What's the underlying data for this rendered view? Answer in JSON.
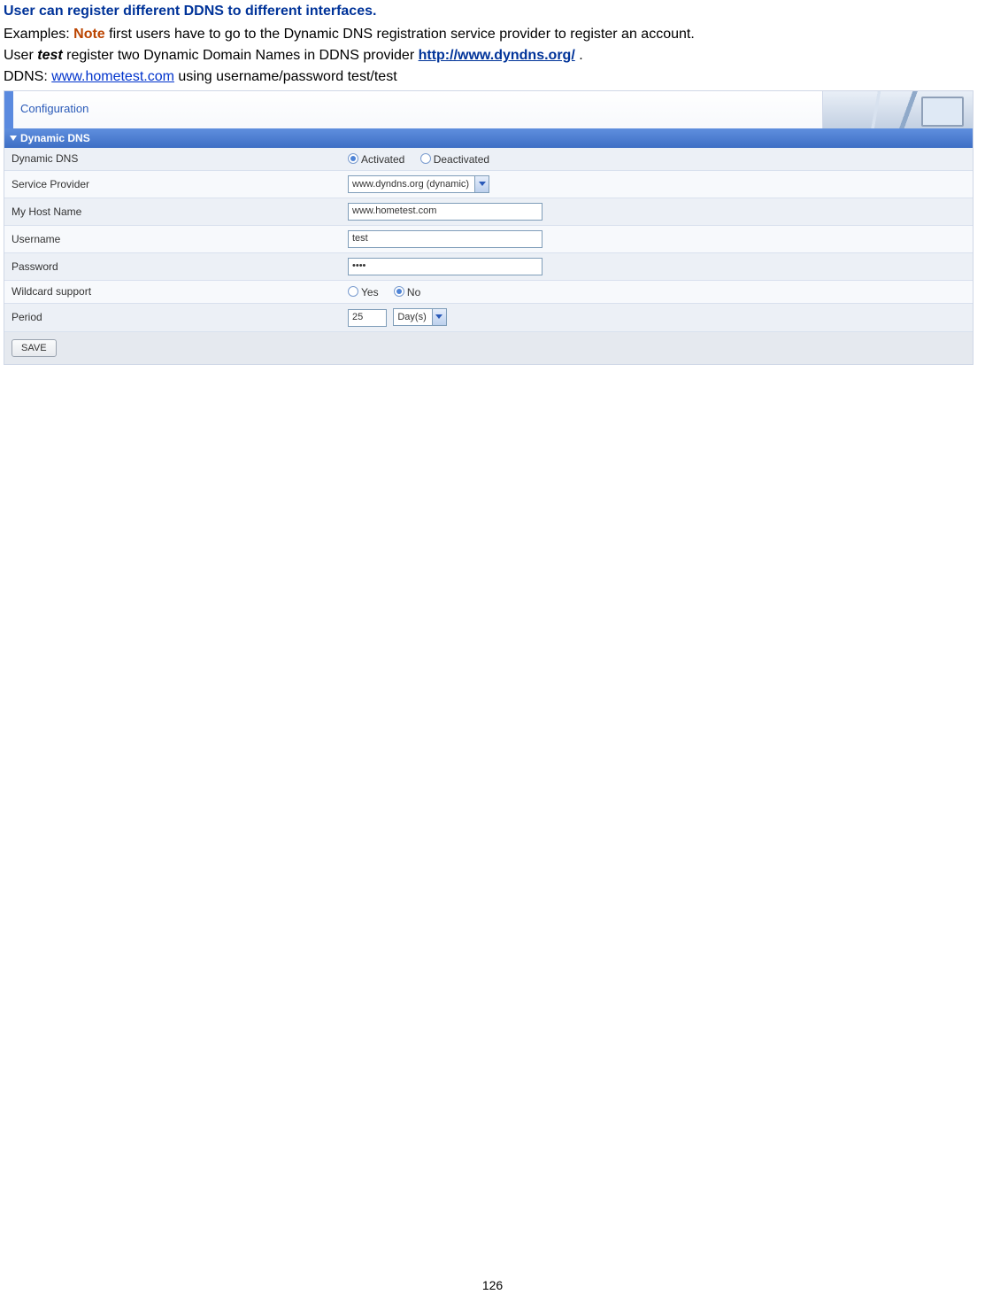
{
  "doc": {
    "heading": "User can register different DDNS to different interfaces.",
    "examples_prefix": "Examples: ",
    "note_word": "Note",
    "examples_rest": " first users have to go to the Dynamic DNS registration service provider to register an account.",
    "line2_a": "User ",
    "line2_user": "test",
    "line2_b": " register two Dynamic Domain Names in DDNS provider ",
    "line2_link": "http://www.dyndns.org/",
    "line2_end": " .",
    "line3_a": "DDNS: ",
    "line3_link": "www.hometest.com",
    "line3_b": " using username/password test/test"
  },
  "ui": {
    "banner_title": "Configuration",
    "section_title": "Dynamic DNS",
    "rows": {
      "dynamic_dns": {
        "label": "Dynamic DNS",
        "opt1": "Activated",
        "opt2": "Deactivated"
      },
      "service_provider": {
        "label": "Service Provider",
        "value": "www.dyndns.org (dynamic)"
      },
      "my_host_name": {
        "label": "My Host Name",
        "value": "www.hometest.com"
      },
      "username": {
        "label": "Username",
        "value": "test"
      },
      "password": {
        "label": "Password",
        "value": "••••"
      },
      "wildcard": {
        "label": "Wildcard support",
        "opt1": "Yes",
        "opt2": "No"
      },
      "period": {
        "label": "Period",
        "value": "25",
        "unit": "Day(s)"
      }
    },
    "save_label": "SAVE"
  },
  "page_number": "126"
}
